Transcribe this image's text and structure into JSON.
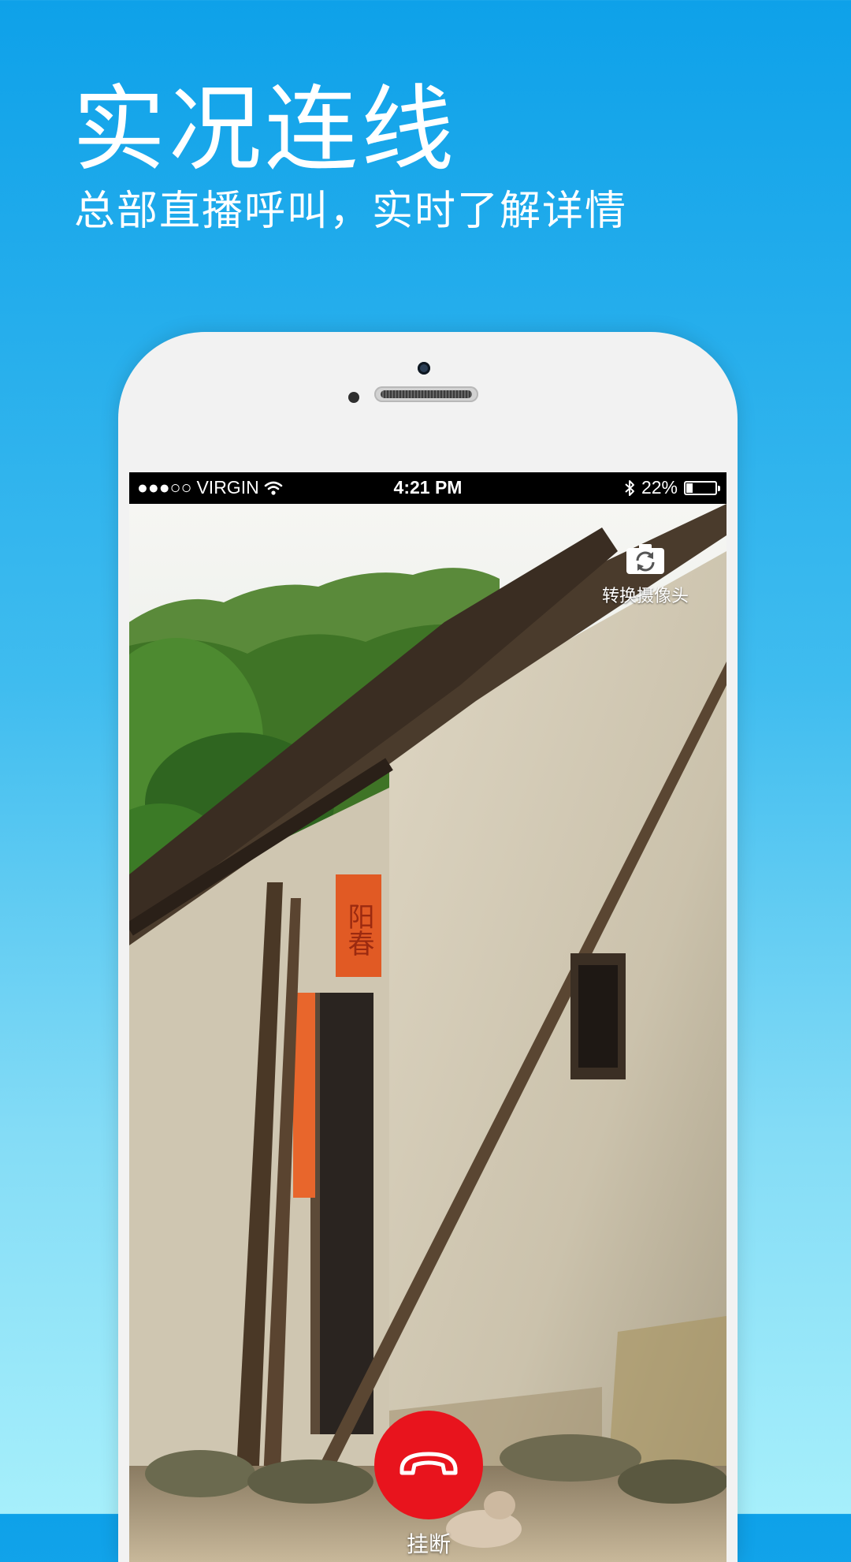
{
  "promo": {
    "title": "实况连线",
    "subtitle": "总部直播呼叫，实时了解详情"
  },
  "status_bar": {
    "signal": "●●●○○",
    "carrier": "VIRGIN",
    "time": "4:21 PM",
    "battery_percent": "22%",
    "battery_level": 0.22
  },
  "video": {
    "switch_camera_label": "转换摄像头",
    "hangup_label": "挂断",
    "couplet_text": "阳春",
    "hangup_color": "#e8141d"
  },
  "icons": [
    "wifi-icon",
    "bluetooth-icon",
    "battery-icon",
    "camera-switch-icon",
    "hangup-phone-icon"
  ]
}
